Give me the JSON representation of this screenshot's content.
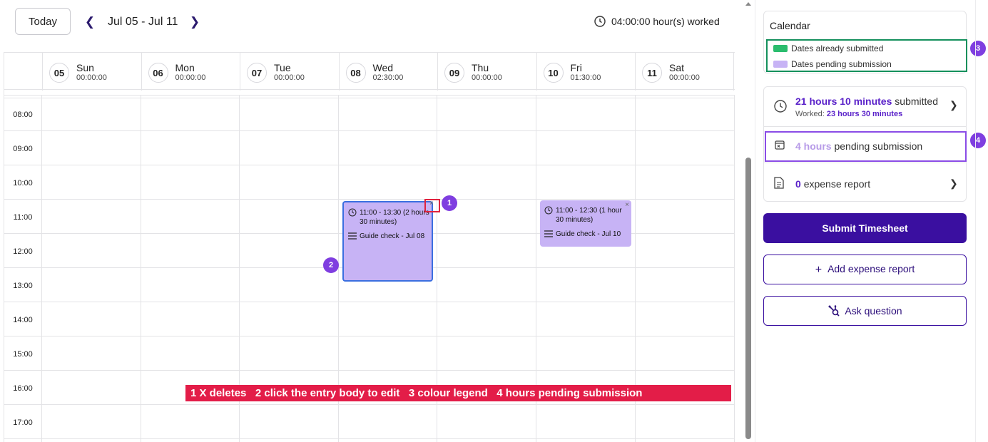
{
  "toolbar": {
    "today_label": "Today",
    "range_label": "Jul 05 - Jul 11",
    "worked_label": "04:00:00 hour(s) worked"
  },
  "days": [
    {
      "num": "05",
      "name": "Sun",
      "time": "00:00:00"
    },
    {
      "num": "06",
      "name": "Mon",
      "time": "00:00:00"
    },
    {
      "num": "07",
      "name": "Tue",
      "time": "00:00:00"
    },
    {
      "num": "08",
      "name": "Wed",
      "time": "02:30:00"
    },
    {
      "num": "09",
      "name": "Thu",
      "time": "00:00:00"
    },
    {
      "num": "10",
      "name": "Fri",
      "time": "01:30:00"
    },
    {
      "num": "11",
      "name": "Sat",
      "time": "00:00:00"
    }
  ],
  "hours": [
    "08:00",
    "09:00",
    "10:00",
    "11:00",
    "12:00",
    "13:00",
    "14:00",
    "15:00",
    "16:00",
    "17:00"
  ],
  "events": [
    {
      "time": "11:00 - 13:30 (2 hours 30 minutes)",
      "description": "Guide check - Jul 08",
      "close": "×"
    },
    {
      "time": "11:00 - 12:30 (1 hour 30 minutes)",
      "description": "Guide check - Jul 10",
      "close": "×"
    }
  ],
  "badges": [
    "1",
    "2",
    "3",
    "4"
  ],
  "banner": "1 X deletes   2 click the entry body to edit   3 colour legend   4 hours pending submission",
  "legend": {
    "title": "Calendar",
    "items": [
      {
        "label": "Dates already submitted",
        "color": "#2bbd6e"
      },
      {
        "label": "Dates pending submission",
        "color": "#c7b3f5"
      }
    ]
  },
  "summary": {
    "submitted_value": "21 hours 10 minutes",
    "submitted_label": "submitted",
    "worked_label": "Worked:",
    "worked_value": "23 hours 30 minutes",
    "pending_value": "4 hours",
    "pending_label": "pending submission",
    "expense_value": "0",
    "expense_label": "expense report"
  },
  "actions": {
    "submit": "Submit Timesheet",
    "add_expense": "Add expense report",
    "ask_question": "Ask question"
  },
  "colors": {
    "accent": "#3a0fa0",
    "event": "#c7b3f5",
    "submitted": "#2bbd6e",
    "banner": "#e31d48"
  }
}
